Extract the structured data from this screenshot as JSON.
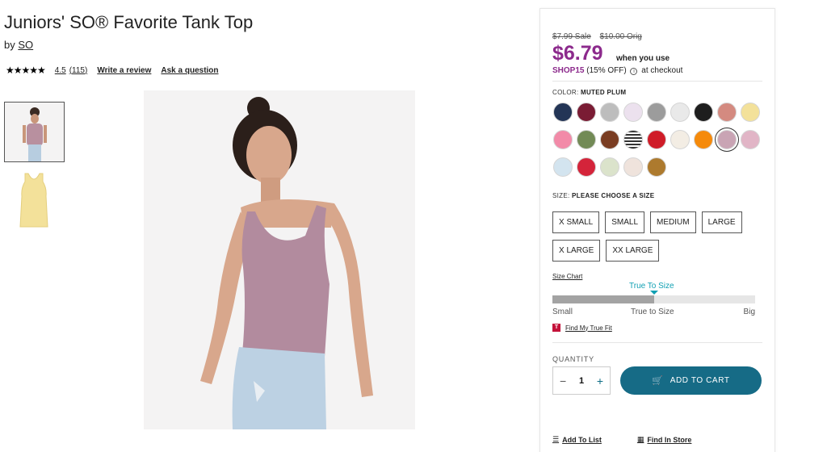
{
  "product": {
    "title": "Juniors' SO® Favorite Tank Top",
    "by_prefix": "by",
    "brand": "SO",
    "stars": "★★★★★",
    "rating": "4.5",
    "review_count": "(115)",
    "write_review": "Write a review",
    "ask_question": "Ask a question"
  },
  "price": {
    "sale": "$7.99 Sale",
    "orig": "$10.00 Orig",
    "promo_price": "$6.79",
    "when_you_use": "when you use",
    "promo_code": "SHOP15",
    "promo_pct": "(15% OFF)",
    "info_glyph": "i",
    "at_checkout": "at checkout"
  },
  "color": {
    "label": "COLOR:",
    "selected": "MUTED PLUM",
    "swatches": [
      {
        "hex": "#233556",
        "icon": "swatch-navy"
      },
      {
        "hex": "#7a1c34",
        "icon": "swatch-burgundy"
      },
      {
        "hex": "#bdbdbd",
        "icon": "swatch-heather-gray"
      },
      {
        "hex": "#ece1ee",
        "icon": "swatch-lavender"
      },
      {
        "hex": "#9c9c9c",
        "icon": "swatch-gray"
      },
      {
        "hex": "#e9e9e9",
        "icon": "swatch-light-gray"
      },
      {
        "hex": "#1e1e1e",
        "icon": "swatch-black"
      },
      {
        "hex": "#d48a80",
        "icon": "swatch-coral"
      },
      {
        "hex": "#f3e19a",
        "icon": "swatch-yellow"
      },
      {
        "hex": "#f28aa8",
        "icon": "swatch-pink"
      },
      {
        "hex": "#728a56",
        "icon": "swatch-olive"
      },
      {
        "hex": "#7a3d22",
        "icon": "swatch-brown"
      },
      {
        "hex": "#444444",
        "icon": "swatch-stripe"
      },
      {
        "hex": "#cf1c28",
        "icon": "swatch-red"
      },
      {
        "hex": "#f3ede4",
        "icon": "swatch-floral"
      },
      {
        "hex": "#f58a0b",
        "icon": "swatch-orange"
      },
      {
        "hex": "#c9a4b4",
        "icon": "swatch-muted-plum",
        "selected": true
      },
      {
        "hex": "#e1b5c6",
        "icon": "swatch-pink-light"
      },
      {
        "hex": "#d3e4ef",
        "icon": "swatch-blue-print"
      },
      {
        "hex": "#d4243a",
        "icon": "swatch-red-2"
      },
      {
        "hex": "#dbe3cb",
        "icon": "swatch-sage-print"
      },
      {
        "hex": "#efe3dc",
        "icon": "swatch-blush"
      },
      {
        "hex": "#ad7a2e",
        "icon": "swatch-gold"
      }
    ]
  },
  "size": {
    "label": "SIZE:",
    "prompt": "PLEASE CHOOSE A SIZE",
    "options": [
      "X SMALL",
      "SMALL",
      "MEDIUM",
      "LARGE",
      "X LARGE",
      "XX LARGE"
    ],
    "size_chart": "Size Chart"
  },
  "fit": {
    "title": "True To Size",
    "level": 0.5,
    "labels": [
      "Small",
      "True to Size",
      "Big"
    ],
    "truefit_badge": "T",
    "truefit": "Find My True Fit"
  },
  "quantity": {
    "label": "QUANTITY",
    "value": "1",
    "minus": "−",
    "plus": "+"
  },
  "cart": {
    "cart_glyph": "🛒",
    "add_to_cart": "ADD TO CART"
  },
  "links": {
    "add_list_glyph": "☰",
    "add_to_list": "Add To List",
    "store_glyph": "▦",
    "find_in_store": "Find In Store"
  },
  "colors": {
    "promo_purple": "#8c2a8c",
    "cart_teal": "#166b86",
    "fit_teal": "#11a0b3"
  }
}
